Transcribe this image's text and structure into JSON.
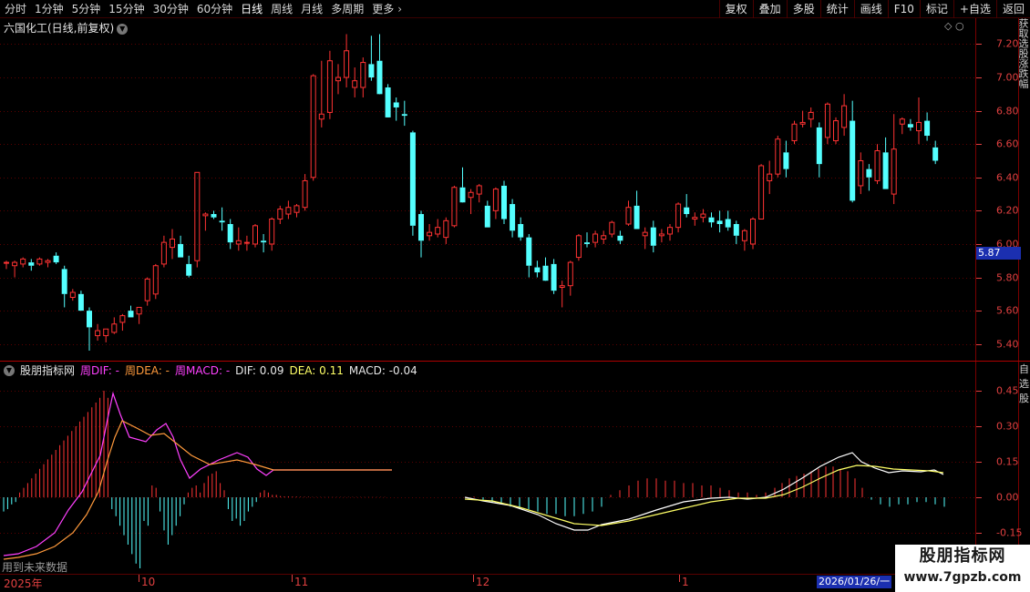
{
  "toolbar": {
    "periods": [
      "分时",
      "1分钟",
      "5分钟",
      "15分钟",
      "30分钟",
      "60分钟",
      "日线",
      "周线",
      "月线",
      "多周期",
      "更多"
    ],
    "active_period": "日线",
    "tools": [
      "复权",
      "叠加",
      "多股",
      "统计",
      "画线",
      "F10",
      "标记",
      "+自选",
      "返回"
    ]
  },
  "stock": {
    "title": "六国化工(日线,前复权)",
    "current_price": "5.87"
  },
  "indicator": {
    "name": "股朋指标网",
    "week_dif": "周DIF: -",
    "week_dea": "周DEA: -",
    "week_macd": "周MACD: -",
    "dif": "DIF: 0.09",
    "dea": "DEA: 0.11",
    "macd": "MACD: -0.04"
  },
  "price_axis": [
    "7.20",
    "7.00",
    "6.80",
    "6.60",
    "6.40",
    "6.20",
    "6.00",
    "5.80",
    "5.60",
    "5.40"
  ],
  "indicator_axis": [
    "0.45",
    "0.30",
    "0.15",
    "0.00",
    "-0.15"
  ],
  "future_note": "用到未来数据",
  "date_axis": {
    "year_label": "2025年",
    "months": [
      "10",
      "11",
      "12",
      "1"
    ],
    "cursor_date": "2026/01/26/一"
  },
  "right_panel_text": "获取选股涨跌幅",
  "right_panel_text2": "自选股",
  "watermark": {
    "name": "股朋指标网",
    "url": "www.7gpzb.com"
  },
  "colors": {
    "up": "#ff3333",
    "down": "#54ffff",
    "dif_line": "#ffffff",
    "dea_line": "#ffff66",
    "week_dif_line": "#ff40ff",
    "week_dea_line": "#ff9a3c",
    "axis": "#e04040"
  },
  "chart_data": {
    "type": "candlestick",
    "ylim": [
      5.3,
      7.35
    ],
    "candles": [
      [
        5.89,
        5.9,
        5.85,
        5.89
      ],
      [
        5.87,
        5.9,
        5.8,
        5.89
      ],
      [
        5.88,
        5.92,
        5.86,
        5.91
      ],
      [
        5.89,
        5.91,
        5.84,
        5.87
      ],
      [
        5.88,
        5.92,
        5.87,
        5.91
      ],
      [
        5.89,
        5.91,
        5.86,
        5.9
      ],
      [
        5.93,
        5.95,
        5.88,
        5.89
      ],
      [
        5.85,
        5.87,
        5.62,
        5.7
      ],
      [
        5.68,
        5.73,
        5.66,
        5.71
      ],
      [
        5.7,
        5.72,
        5.61,
        5.6
      ],
      [
        5.6,
        5.62,
        5.36,
        5.5
      ],
      [
        5.45,
        5.52,
        5.42,
        5.48
      ],
      [
        5.45,
        5.49,
        5.41,
        5.49
      ],
      [
        5.47,
        5.56,
        5.46,
        5.52
      ],
      [
        5.53,
        5.58,
        5.48,
        5.57
      ],
      [
        5.6,
        5.63,
        5.56,
        5.56
      ],
      [
        5.58,
        5.62,
        5.52,
        5.62
      ],
      [
        5.66,
        5.8,
        5.63,
        5.79
      ],
      [
        5.7,
        5.88,
        5.67,
        5.87
      ],
      [
        5.88,
        6.05,
        5.86,
        6.01
      ],
      [
        5.98,
        6.09,
        5.91,
        6.03
      ],
      [
        6.0,
        6.05,
        5.92,
        5.92
      ],
      [
        5.88,
        5.93,
        5.8,
        5.81
      ],
      [
        5.9,
        6.43,
        5.86,
        6.43
      ],
      [
        6.17,
        6.19,
        6.08,
        6.18
      ],
      [
        6.18,
        6.2,
        6.15,
        6.16
      ],
      [
        6.14,
        6.22,
        6.08,
        6.13
      ],
      [
        6.12,
        6.15,
        5.97,
        6.01
      ],
      [
        6.0,
        6.1,
        5.96,
        6.02
      ],
      [
        6.01,
        6.05,
        5.96,
        6.01
      ],
      [
        6.0,
        6.12,
        5.98,
        6.11
      ],
      [
        6.02,
        6.06,
        5.95,
        6.01
      ],
      [
        6.0,
        6.16,
        5.96,
        6.15
      ],
      [
        6.15,
        6.23,
        6.12,
        6.21
      ],
      [
        6.18,
        6.26,
        6.15,
        6.22
      ],
      [
        6.19,
        6.24,
        6.16,
        6.23
      ],
      [
        6.22,
        6.42,
        6.2,
        6.38
      ],
      [
        6.4,
        7.02,
        6.38,
        7.01
      ],
      [
        6.75,
        7.1,
        6.7,
        6.78
      ],
      [
        6.79,
        7.16,
        6.75,
        7.1
      ],
      [
        6.98,
        7.08,
        6.9,
        7.0
      ],
      [
        7.0,
        7.26,
        6.94,
        7.16
      ],
      [
        6.94,
        7.06,
        6.88,
        6.98
      ],
      [
        6.94,
        7.12,
        6.88,
        7.09
      ],
      [
        7.08,
        7.25,
        6.98,
        7.0
      ],
      [
        7.1,
        7.26,
        6.96,
        6.9
      ],
      [
        6.94,
        6.96,
        6.8,
        6.76
      ],
      [
        6.85,
        6.88,
        6.74,
        6.82
      ],
      [
        6.78,
        6.86,
        6.71,
        6.77
      ],
      [
        6.67,
        6.68,
        6.05,
        6.11
      ],
      [
        6.18,
        6.2,
        5.92,
        6.02
      ],
      [
        6.05,
        6.12,
        6.02,
        6.07
      ],
      [
        6.06,
        6.15,
        6.04,
        6.1
      ],
      [
        6.04,
        6.16,
        6.0,
        6.14
      ],
      [
        6.11,
        6.35,
        6.1,
        6.34
      ],
      [
        6.34,
        6.46,
        6.28,
        6.25
      ],
      [
        6.28,
        6.33,
        6.18,
        6.31
      ],
      [
        6.3,
        6.36,
        6.25,
        6.35
      ],
      [
        6.23,
        6.26,
        6.1,
        6.1
      ],
      [
        6.2,
        6.34,
        6.15,
        6.33
      ],
      [
        6.35,
        6.38,
        6.12,
        6.15
      ],
      [
        6.24,
        6.27,
        6.04,
        6.08
      ],
      [
        6.12,
        6.16,
        6.02,
        6.04
      ],
      [
        6.04,
        6.06,
        5.8,
        5.87
      ],
      [
        5.86,
        5.9,
        5.8,
        5.83
      ],
      [
        5.87,
        5.92,
        5.8,
        5.78
      ],
      [
        5.88,
        5.91,
        5.7,
        5.72
      ],
      [
        5.74,
        5.78,
        5.62,
        5.75
      ],
      [
        5.75,
        5.9,
        5.69,
        5.89
      ],
      [
        5.92,
        6.06,
        5.9,
        6.05
      ],
      [
        6.01,
        6.07,
        5.98,
        6.0
      ],
      [
        6.01,
        6.08,
        5.98,
        6.06
      ],
      [
        6.03,
        6.08,
        6.0,
        6.05
      ],
      [
        6.06,
        6.14,
        6.04,
        6.13
      ],
      [
        6.05,
        6.08,
        6.0,
        6.02
      ],
      [
        6.12,
        6.26,
        6.11,
        6.22
      ],
      [
        6.23,
        6.32,
        6.1,
        6.09
      ],
      [
        6.05,
        6.1,
        5.97,
        6.07
      ],
      [
        6.1,
        6.14,
        5.95,
        5.99
      ],
      [
        6.05,
        6.09,
        6.01,
        6.06
      ],
      [
        6.06,
        6.12,
        6.02,
        6.1
      ],
      [
        6.1,
        6.25,
        6.07,
        6.24
      ],
      [
        6.22,
        6.3,
        6.16,
        6.18
      ],
      [
        6.15,
        6.19,
        6.11,
        6.16
      ],
      [
        6.16,
        6.21,
        6.13,
        6.18
      ],
      [
        6.16,
        6.19,
        6.1,
        6.13
      ],
      [
        6.14,
        6.2,
        6.07,
        6.12
      ],
      [
        6.15,
        6.2,
        6.08,
        6.1
      ],
      [
        6.12,
        6.14,
        6.0,
        6.05
      ],
      [
        6.02,
        6.09,
        5.96,
        6.08
      ],
      [
        6.0,
        6.16,
        5.97,
        6.15
      ],
      [
        6.15,
        6.48,
        6.15,
        6.47
      ],
      [
        6.38,
        6.5,
        6.3,
        6.42
      ],
      [
        6.42,
        6.65,
        6.4,
        6.63
      ],
      [
        6.55,
        6.62,
        6.4,
        6.45
      ],
      [
        6.62,
        6.74,
        6.6,
        6.72
      ],
      [
        6.72,
        6.8,
        6.7,
        6.73
      ],
      [
        6.75,
        6.82,
        6.7,
        6.79
      ],
      [
        6.7,
        6.73,
        6.4,
        6.48
      ],
      [
        6.64,
        6.85,
        6.6,
        6.84
      ],
      [
        6.62,
        6.76,
        6.6,
        6.74
      ],
      [
        6.7,
        6.9,
        6.65,
        6.83
      ],
      [
        6.74,
        6.86,
        6.25,
        6.26
      ],
      [
        6.35,
        6.55,
        6.3,
        6.5
      ],
      [
        6.45,
        6.48,
        6.32,
        6.4
      ],
      [
        6.38,
        6.6,
        6.36,
        6.56
      ],
      [
        6.55,
        6.64,
        6.33,
        6.33
      ],
      [
        6.3,
        6.78,
        6.24,
        6.57
      ],
      [
        6.72,
        6.76,
        6.66,
        6.75
      ],
      [
        6.72,
        6.75,
        6.68,
        6.7
      ],
      [
        6.68,
        6.88,
        6.6,
        6.73
      ],
      [
        6.74,
        6.79,
        6.62,
        6.65
      ],
      [
        6.58,
        6.62,
        6.48,
        6.5
      ]
    ],
    "macd_hist": [
      -0.06,
      -0.05,
      -0.03,
      -0.02,
      0.02,
      0.04,
      0.06,
      0.08,
      0.1,
      0.12,
      0.14,
      0.16,
      0.18,
      0.2,
      0.22,
      0.24,
      0.26,
      0.28,
      0.3,
      0.32,
      0.34,
      0.36,
      0.38,
      0.4,
      0.42,
      0.45,
      0.42,
      -0.05,
      -0.08,
      -0.12,
      -0.16,
      -0.2,
      -0.24,
      -0.28,
      -0.3,
      -0.1,
      -0.12,
      0.05,
      0.04,
      -0.06,
      -0.14,
      -0.2,
      -0.16,
      -0.12,
      -0.08,
      -0.03,
      0.02,
      0.04,
      0.05,
      0.02,
      0.06,
      0.09,
      0.1,
      0.11,
      0.06,
      0.03,
      -0.05,
      -0.1,
      -0.09,
      -0.12,
      -0.1,
      -0.06,
      -0.04,
      -0.02,
      0.02,
      0.03,
      0.02,
      0.01,
      0.01,
      0.005,
      0.004,
      0.004,
      0.003,
      0.003,
      0.002,
      0.002,
      0.002,
      0.001,
      0.001,
      0.001,
      0.001,
      0.001,
      0.001,
      0.001,
      0.001,
      0.001,
      0.001,
      0.001,
      0.001,
      0.001,
      0.001,
      0.001,
      0.001,
      0.001,
      0.001,
      0.001
    ],
    "series": [
      {
        "name": "DIF",
        "values": []
      },
      {
        "name": "DEA",
        "values": []
      }
    ]
  }
}
